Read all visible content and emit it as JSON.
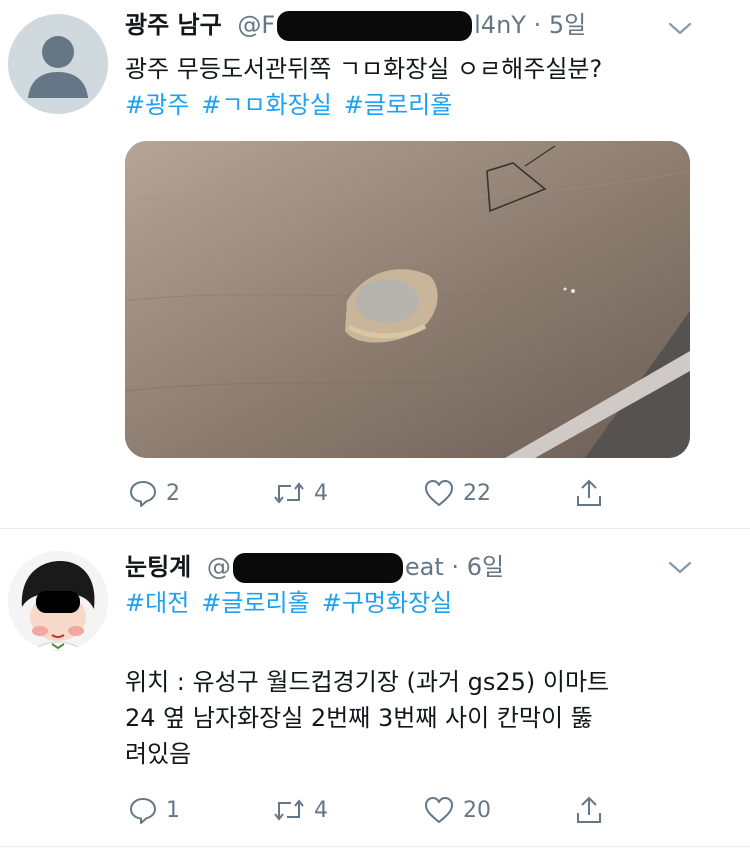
{
  "tweets": [
    {
      "name": "광주 남구",
      "handle_visible_start": "@F",
      "handle_visible_end": "l4nY",
      "dot": "·",
      "time": "5일",
      "text": "광주 무등도서관뒤쪽 ㄱㅁ화장실 ㅇㄹ해주실분?",
      "hashtags": [
        "#광주",
        "#ㄱㅁ화장실",
        "#글로리홀"
      ],
      "replies": "2",
      "retweets": "4",
      "likes": "22"
    },
    {
      "name": "눈팅계",
      "handle_visible_start": "@",
      "handle_visible_end": "eat",
      "dot": "·",
      "time": "6일",
      "hashtags": [
        "#대전",
        "#글로리홀",
        "#구멍화장실"
      ],
      "text": "위치 : 유성구 월드컵경기장 (과거 gs25) 이마트\n24 옆 남자화장실 2번째 3번째 사이 칸막이 뚫\n려있음",
      "replies": "1",
      "retweets": "4",
      "likes": "20"
    }
  ],
  "icons": {
    "reply": "reply-icon",
    "retweet": "retweet-icon",
    "like": "heart-icon",
    "share": "share-icon",
    "more": "chevron-down-icon"
  },
  "colors": {
    "link": "#1da1f2",
    "secondary": "#657786",
    "divider": "#e6ecf0"
  }
}
